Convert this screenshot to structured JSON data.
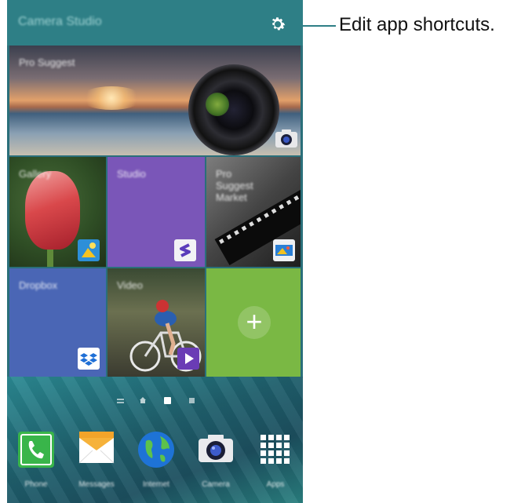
{
  "app_bar": {
    "title": "Camera Studio",
    "settings_icon": "gear-icon"
  },
  "callout": {
    "text": "Edit app shortcuts."
  },
  "tiles": {
    "pro_suggest": {
      "label": "Pro Suggest",
      "badge_icon": "camera-icon"
    },
    "gallery": {
      "label": "Gallery",
      "badge_icon": "gallery-icon"
    },
    "studio": {
      "label": "Studio",
      "badge_icon": "studio-s-icon"
    },
    "pro_suggest_market": {
      "label": "Pro Suggest Market",
      "badge_icon": "film-icon"
    },
    "dropbox": {
      "label": "Dropbox",
      "badge_icon": "dropbox-icon"
    },
    "video": {
      "label": "Video",
      "badge_icon": "play-icon"
    },
    "add": {
      "symbol": "+"
    }
  },
  "page_indicator": {
    "pages": 4,
    "current": 3
  },
  "dock": [
    {
      "label": "Phone",
      "icon": "phone-icon"
    },
    {
      "label": "Messages",
      "icon": "messages-icon"
    },
    {
      "label": "Internet",
      "icon": "globe-icon"
    },
    {
      "label": "Camera",
      "icon": "camera-icon"
    },
    {
      "label": "Apps",
      "icon": "apps-grid-icon"
    }
  ],
  "colors": {
    "app_bar": "#2e7f86",
    "studio": "#7a56b8",
    "dropbox": "#4a66b5",
    "add_tile": "#7ab844"
  }
}
